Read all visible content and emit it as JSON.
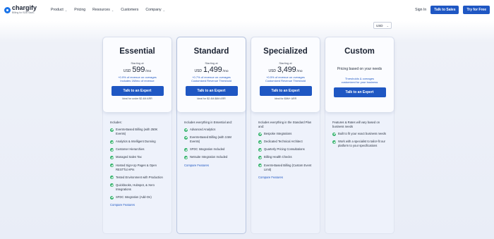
{
  "nav": {
    "brand": "chargify",
    "brand_tag": "Billing for B2B SaaS",
    "menu": [
      {
        "label": "Product",
        "dropdown": true
      },
      {
        "label": "Pricing",
        "dropdown": false
      },
      {
        "label": "Resources",
        "dropdown": true
      },
      {
        "label": "Customers",
        "dropdown": false
      },
      {
        "label": "Company",
        "dropdown": true
      }
    ],
    "sign_in": "Sign In",
    "talk_sales": "Talk to Sales",
    "try_free": "Try for Free",
    "chevron": "⌄"
  },
  "currency": {
    "selected": "USD",
    "chevron": "⌄"
  },
  "colors": {
    "primary": "#1f57c3",
    "check": "#34b36b"
  },
  "plans": [
    {
      "name": "Essential",
      "starting": "Starting at",
      "currency": "USD",
      "price": "599",
      "per": "/mo",
      "notes": [
        "+0.9% of revenue on overages",
        "Includes 1M/mo of revenue"
      ],
      "cta": "Talk to an Expert",
      "ideal": "Ideal for under $2.4M ARR",
      "features_intro": "Includes:",
      "features": [
        "Events-Based Billing (with 250K Events)",
        "Analytics & Intelligent Dunning",
        "Customer Hierarchies",
        "Managed Sales Tax",
        "Hosted Sign-Up Pages & Open REST’ful APIs",
        "Tested Environment with Production",
        "Quickbooks, Hubspot, & Xero Integrations",
        "SFDC Integration (Add-On)"
      ],
      "compare": "Compare Features"
    },
    {
      "name": "Standard",
      "starting": "Starting at",
      "currency": "USD",
      "price": "1,499",
      "per": "/mo",
      "notes": [
        "+0.7% of revenue on overages",
        "Customized Revenue Threshold"
      ],
      "cta": "Talk to an Expert",
      "ideal": "Ideal for $2.4M-$8M ARR",
      "features_intro": "Includes everything in Essential and:",
      "features": [
        "Advanced Analytics",
        "Events-Based Billing (with 3.5M Events)",
        "SFDC Integration Included",
        "Netsuite Integration Included"
      ],
      "compare": "Compare Features"
    },
    {
      "name": "Specialized",
      "starting": "Starting at",
      "currency": "USD",
      "price": "3,499",
      "per": "/mo",
      "notes": [
        "+0.5% of revenue on overages",
        "Customized Revenue Threshold"
      ],
      "cta": "Talk to an Expert",
      "ideal": "Ideal for $8M+ ARR",
      "features_intro": "Includes everything in the Standard Plan and:",
      "features": [
        "Bespoke Integrations",
        "Dedicated Technical Architect",
        "Quarterly Pricing Consultations",
        "Billing Health Checks",
        "Events-Based Billing (Custom Event Limit)"
      ],
      "compare": "Compare Features"
    },
    {
      "name": "Custom",
      "subtitle": "Pricing based on your needs",
      "notes": [
        "Thresholds & overages",
        "customized for your business"
      ],
      "cta": "Talk to an Expert",
      "features_intro": "Features & Rates will vary based on business needs",
      "features": [
        "Built to fit your exact business needs",
        "Work with a specialist to tailor-fit our platform to your specifications"
      ]
    }
  ]
}
